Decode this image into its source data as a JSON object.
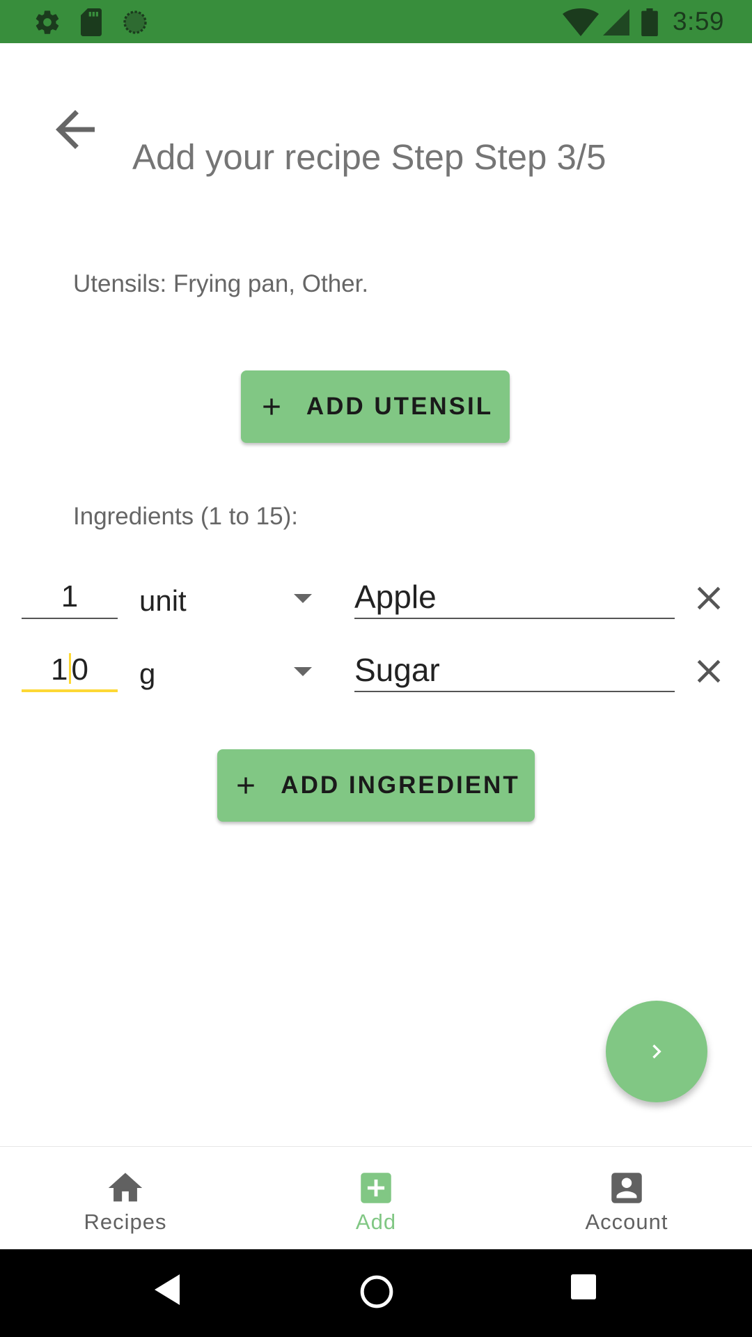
{
  "status_bar": {
    "time": "3:59",
    "left_icons": [
      "gear-icon",
      "sd-card-icon",
      "sync-circle-icon"
    ],
    "right_icons": [
      "wifi-icon",
      "signal-icon",
      "battery-icon"
    ],
    "background": "#388e3c"
  },
  "app_bar": {
    "title": "Add your recipe Step Step 3/5",
    "back_icon": "arrow-left-icon"
  },
  "utensils": {
    "label": "Utensils: Frying pan, Other.",
    "add_button_label": "ADD UTENSIL"
  },
  "ingredients": {
    "label": "Ingredients (1 to 15):",
    "rows": [
      {
        "quantity": "1",
        "unit": "unit",
        "name": "Apple"
      },
      {
        "quantity_before_cursor": "1",
        "quantity_after_cursor": "0",
        "unit": "g",
        "name": "Sugar"
      }
    ],
    "add_button_label": "ADD INGREDIENT"
  },
  "fab": {
    "icon": "chevron-right-icon"
  },
  "bottom_nav": {
    "items": [
      {
        "label": "Recipes",
        "icon": "home-icon"
      },
      {
        "label": "Add",
        "icon": "add-box-icon",
        "active": true
      },
      {
        "label": "Account",
        "icon": "account-box-icon"
      }
    ]
  },
  "colors": {
    "accent": "#81c784",
    "status_bar": "#388e3c",
    "focus_underline": "#fdd835"
  }
}
